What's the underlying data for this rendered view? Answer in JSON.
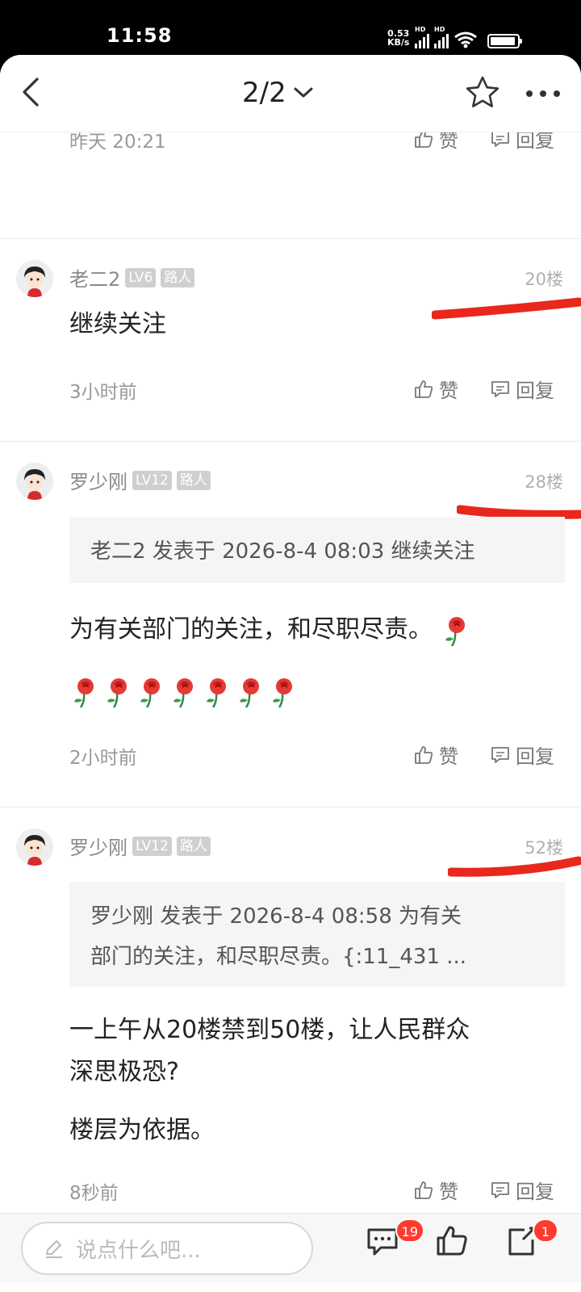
{
  "status_bar": {
    "time": "11:58",
    "net_speed_value": "0.53",
    "net_speed_unit": "KB/s",
    "signal_label": "HD",
    "battery_icon": "battery-icon",
    "wifi_icon": "wifi-icon"
  },
  "header": {
    "page_indicator": "2/2",
    "back_icon": "chevron-left-icon",
    "dropdown_icon": "chevron-down-icon",
    "favorite_icon": "star-icon",
    "more_icon": "more-icon"
  },
  "previous_post": {
    "time": "昨天 20:21",
    "like_label": "赞",
    "reply_label": "回复"
  },
  "posts": [
    {
      "username": "老二2",
      "level": "LV6",
      "title_badge": "路人",
      "floor": "20楼",
      "text": "继续关注",
      "time": "3小时前",
      "like_label": "赞",
      "reply_label": "回复"
    },
    {
      "username": "罗少刚",
      "level": "LV12",
      "title_badge": "路人",
      "floor": "28楼",
      "quote": "老二2 发表于 2026-8-4 08:03 继续关注",
      "text": "为有关部门的关注，和尽职尽责。",
      "time": "2小时前",
      "like_label": "赞",
      "reply_label": "回复"
    },
    {
      "username": "罗少刚",
      "level": "LV12",
      "title_badge": "路人",
      "floor": "52楼",
      "quote_line1": "罗少刚 发表于 2026-8-4 08:58 为有关",
      "quote_line2": "部门的关注，和尽职尽责。{:11_431 ...",
      "text_line1": "一上午从20楼禁到50楼，让人民群众",
      "text_line2": "深思极恐?",
      "text_line3": "楼层为依据。",
      "time": "8秒前",
      "like_label": "赞",
      "reply_label": "回复"
    }
  ],
  "bottom_bar": {
    "input_placeholder": "说点什么吧...",
    "comment_count": "19",
    "share_count": "1",
    "accent_color": "#ff3b30"
  },
  "nav_bar": {
    "menu_icon": "menu-icon",
    "home_icon": "home-icon",
    "back_icon": "back-icon"
  }
}
